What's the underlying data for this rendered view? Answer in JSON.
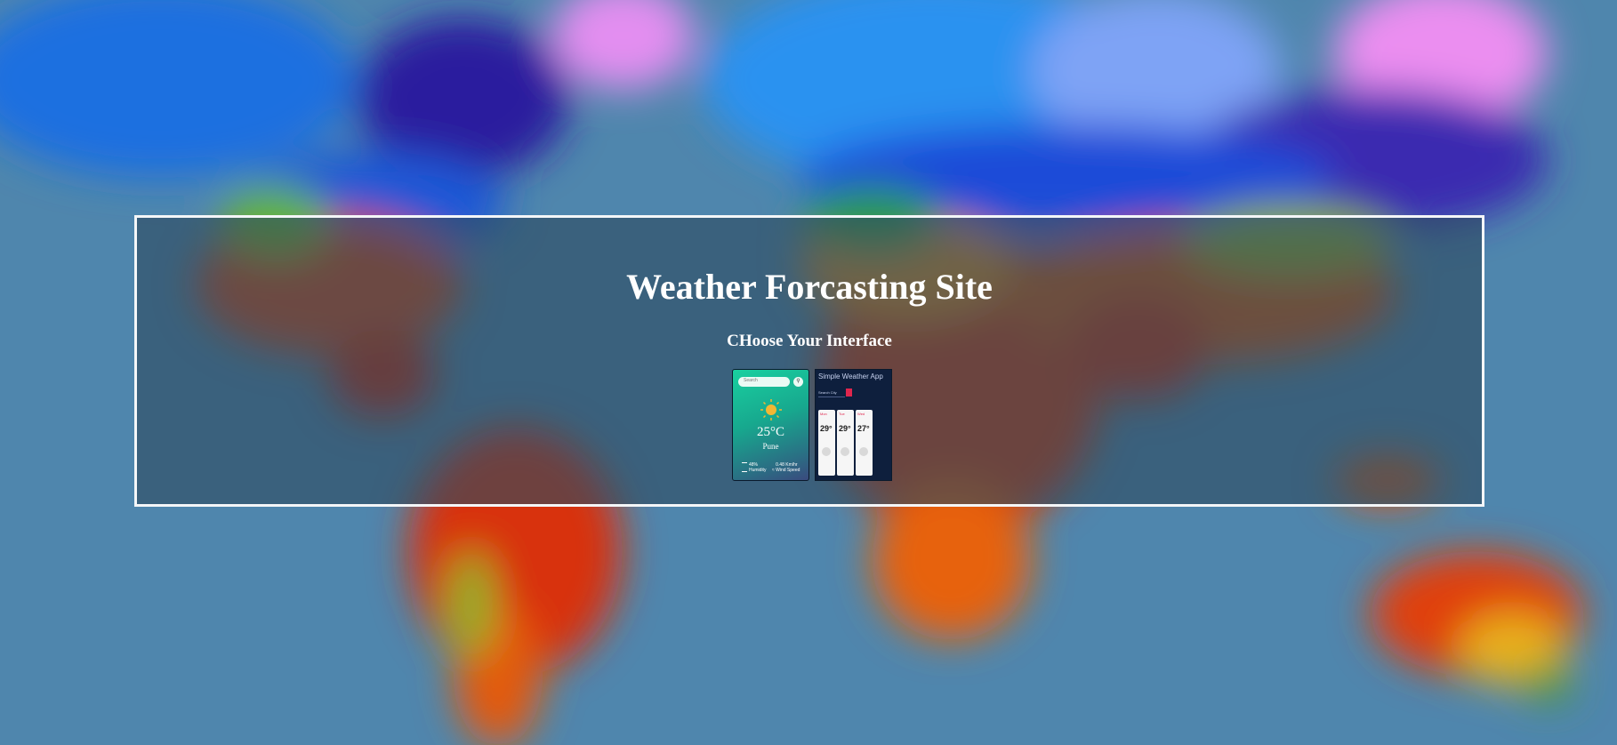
{
  "page": {
    "title": "Weather Forcasting Site",
    "subtitle": "CHoose Your Interface"
  },
  "interfaces": [
    {
      "name": "green-card-interface",
      "search_placeholder": "Search",
      "search_icon": "search-icon",
      "weather_icon": "sun-icon",
      "temperature": "25°C",
      "city": "Pune",
      "humidity_value": "48%",
      "humidity_label": "Humidity",
      "wind_value": "0.48 Km/hr",
      "wind_label": "Wind Speed"
    },
    {
      "name": "dark-app-interface",
      "title": "Simple Weather App",
      "input_value": "Search City",
      "cards": [
        {
          "day": "Mon",
          "temp": "29°"
        },
        {
          "day": "Tue",
          "temp": "29°"
        },
        {
          "day": "Wed",
          "temp": "27°"
        }
      ]
    }
  ],
  "colors": {
    "panel_border": "#f4f6f8",
    "green_card_top": "#19d0a0",
    "dark_app_bg": "#0e1f3d",
    "accent_red": "#e0264d"
  }
}
